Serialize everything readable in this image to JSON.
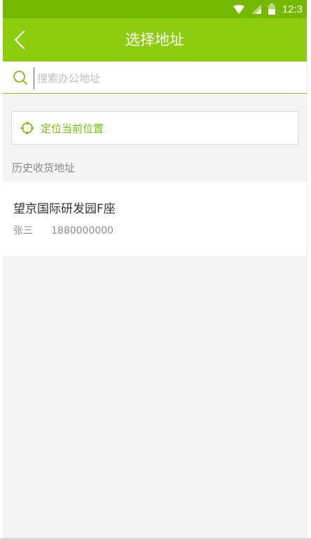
{
  "status_bar": {
    "time": "12:3",
    "icons": [
      "wifi-icon",
      "signal-icon",
      "battery-icon"
    ]
  },
  "header": {
    "title": "选择地址",
    "back_icon": "chevron-left-icon"
  },
  "search": {
    "placeholder": "搜索办公地址",
    "value": "",
    "icon": "search-icon"
  },
  "locate": {
    "label": "定位当前位置",
    "icon": "crosshair-icon"
  },
  "history": {
    "section_label": "历史收货地址",
    "items": [
      {
        "address": "望京国际研发园F座",
        "name": "张三",
        "phone": "1880000000"
      }
    ]
  },
  "colors": {
    "status_bar": "#74b900",
    "app_bar": "#8ccd0d",
    "accent": "#7cc012",
    "background": "#f3f3f3"
  }
}
